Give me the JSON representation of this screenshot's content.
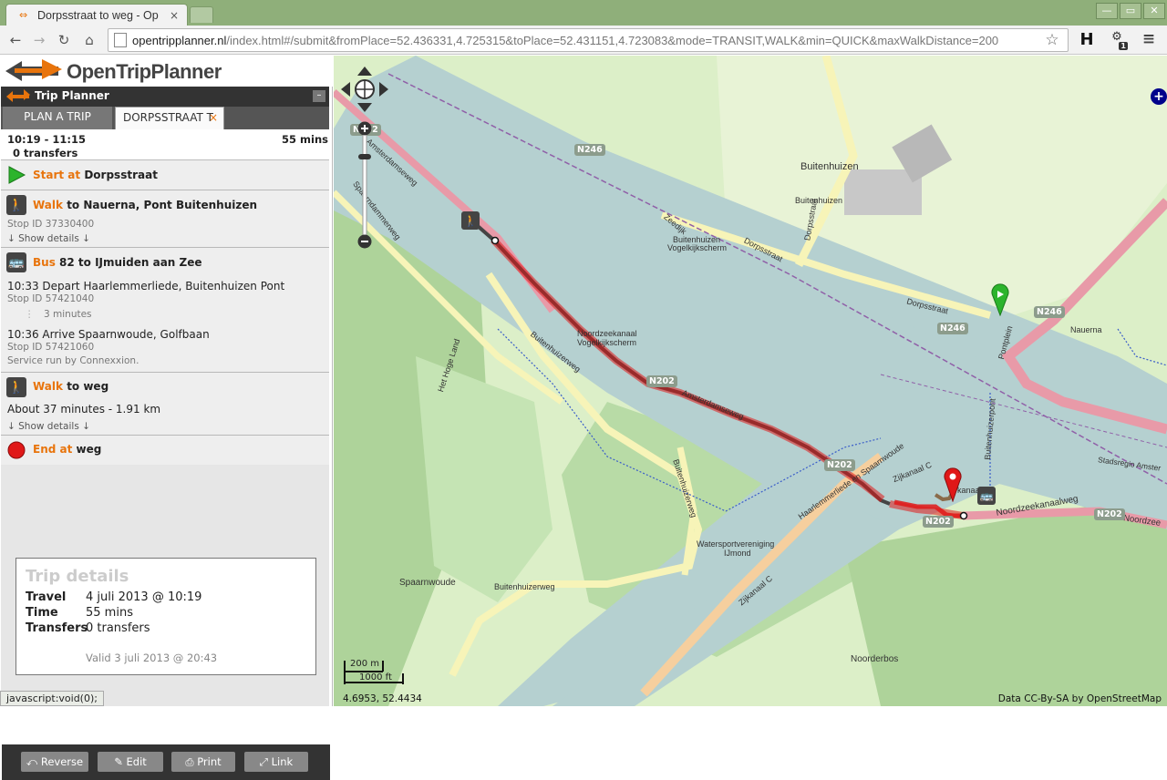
{
  "browser": {
    "tab_title": "Dorpsstraat to weg - Op",
    "tab_close": "×",
    "url_host": "opentripplanner.nl",
    "url_path": "/index.html#/submit&fromPlace=52.436331,4.725315&toPlace=52.431151,4.723083&mode=TRANSIT,WALK&min=QUICK&maxWalkDistance=200",
    "ext_h": "H",
    "ext_badge": "1",
    "status_url": "javascript:void(0);"
  },
  "app": {
    "logo_text": "OpenTripPlanner",
    "panel_title": "Trip Planner",
    "collapse_label": "–",
    "tabs": {
      "plan": "PLAN A TRIP",
      "result": "DORPSSTRAAT T",
      "close": "×"
    }
  },
  "itinerary": {
    "times": "10:19 - 11:15",
    "transfers": "0 transfers",
    "duration": "55 mins",
    "start": {
      "label": "Start at",
      "place": "Dorpsstraat"
    },
    "walk1": {
      "mode": "Walk",
      "to": "to Nauerna, Pont Buitenhuizen",
      "stop": "Stop ID 37330400",
      "details": "↓ Show details ↓"
    },
    "bus": {
      "mode": "Bus",
      "route": "82 to IJmuiden aan Zee",
      "depart": "10:33 Depart Haarlemmerliede, Buitenhuizen Pont",
      "depart_stop": "Stop ID 57421040",
      "ride": "3 minutes",
      "arrive": "10:36 Arrive Spaarnwoude, Golfbaan",
      "arrive_stop": "Stop ID 57421060",
      "operator": "Service run by Connexxion."
    },
    "walk2": {
      "mode": "Walk",
      "to": "to weg",
      "summary": "About 37 minutes - 1.91 km",
      "details": "↓ Show details ↓"
    },
    "end": {
      "label": "End at",
      "place": "weg"
    }
  },
  "trip_details": {
    "title": "Trip details",
    "travel_label": "Travel",
    "travel_value": "4 juli 2013 @ 10:19",
    "time_label": "Time",
    "time_value": "55 mins",
    "transfers_label": "Transfers",
    "transfers_value": "0 transfers",
    "valid": "Valid 3 juli 2013 @ 20:43"
  },
  "actions": {
    "reverse": "Reverse",
    "edit": "Edit",
    "print": "Print",
    "link": "Link"
  },
  "map": {
    "labels": {
      "buitenhuizen": "Buitenhuizen",
      "buitenhuizen2": "Buitenhuizen",
      "vogelkijk": "Buitenhuizen",
      "vogelkijk2": "Vogelkijkscherm",
      "zeedijk": "Zeedijk",
      "dorpsstraat1": "Dorpsstraat",
      "dorpsstraat2": "Dorpsstraat",
      "dorpsstraat3": "Dorpsstraat",
      "nauerna": "Nauerna",
      "pontplein": "Pontplein",
      "nzk_vogel": "Noordzeekanaal",
      "nzk_vogel2": "Vogelkijkscherm",
      "amsterdamseweg1": "Amsterdamseweg",
      "amsterdamseweg2": "Amsterdamseweg",
      "spaarndammerweg": "Spaarndammerweg",
      "buitenhuizerweg1": "Buitenhuizerweg",
      "buitenhuizerweg2": "Buitenhuizerweg",
      "buitenhuizerweg3": "Buitenhuizerweg",
      "hogeland": "Het Hoge Land",
      "haarlemmerliede": "Haarlemmerliede en Spaarnwoude",
      "zijkanaal1": "Zijkanaal C",
      "zijkanaal2": "Zijkanaal C",
      "noordzeekanaalweg": "Noordzeekanaalweg",
      "noordzee2": "Noordzee",
      "watersport1": "Watersportvereniging",
      "watersport2": "IJmond",
      "spaarnwoude": "Spaarnwoude",
      "noorderbos": "Noorderbos",
      "stadsregio": "Stadsregio Amster",
      "pont": "Buitenhuizerpont",
      "kanaal": "kanaal"
    },
    "badges": {
      "n246a": "N246",
      "n246b": "N246",
      "n246c": "N246",
      "n202a": "N202",
      "n202b": "N202",
      "n202c": "N202",
      "n202d": "N202",
      "n202e": "N202"
    },
    "scale_m": "200 m",
    "scale_ft": "1000 ft",
    "coords": "4.6953, 52.4434",
    "attribution": "Data CC-By-SA by  OpenStreetMap"
  },
  "colors": {
    "accent": "#e8740c",
    "route": "#e01818",
    "water": "#b5d0d0",
    "land": "#d9edc6"
  }
}
